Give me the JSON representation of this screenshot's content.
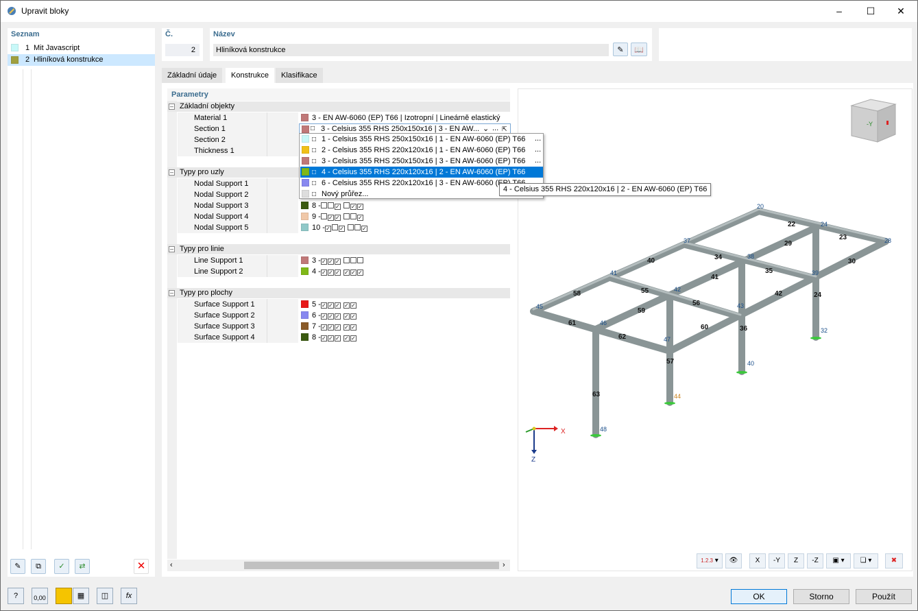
{
  "window": {
    "title": "Upravit bloky",
    "min_icon": "minimize-icon",
    "max_icon": "maximize-icon",
    "close_icon": "close-icon"
  },
  "list": {
    "header": "Seznam",
    "items": [
      {
        "num": "1",
        "name": "Mit Javascript",
        "color": "#c8f8f8"
      },
      {
        "num": "2",
        "name": "Hliníková konstrukce",
        "color": "#a0a040"
      }
    ]
  },
  "number": {
    "label": "Č.",
    "value": "2"
  },
  "name": {
    "label": "Název",
    "value": "Hliníková konstrukce"
  },
  "tabs": [
    "Základní údaje",
    "Konstrukce",
    "Klasifikace"
  ],
  "params": {
    "header": "Parametry"
  },
  "groups": {
    "basic": {
      "title": "Základní objekty",
      "rows": [
        {
          "label": "Material 1",
          "value": "3 - EN AW-6060 (EP) T66 | Izotropní | Lineárně elastický",
          "color": "#c07878"
        },
        {
          "label": "Section 1",
          "value": "3 - Celsius 355 RHS 250x150x16 | 3 - EN AW...",
          "color": "#c07878"
        },
        {
          "label": "Section 2"
        },
        {
          "label": "Thickness 1"
        }
      ]
    },
    "nodes": {
      "title": "Typy pro uzly",
      "rows": [
        {
          "label": "Nodal Support 1"
        },
        {
          "label": "Nodal Support 2"
        },
        {
          "label": "Nodal Support 3",
          "num": "8 -",
          "color": "#3a5a10"
        },
        {
          "label": "Nodal Support 4",
          "num": "9 -",
          "color": "#f0c8a8"
        },
        {
          "label": "Nodal Support 5",
          "num": "10 -",
          "color": "#90c8c8"
        }
      ]
    },
    "lines": {
      "title": "Typy pro linie",
      "rows": [
        {
          "label": "Line Support 1",
          "num": "3 -",
          "color": "#c07878"
        },
        {
          "label": "Line Support 2",
          "num": "4 -",
          "color": "#80b818"
        }
      ]
    },
    "surfaces": {
      "title": "Typy pro plochy",
      "rows": [
        {
          "label": "Surface Support 1",
          "num": "5 -",
          "color": "#e81818"
        },
        {
          "label": "Surface Support 2",
          "num": "6 -",
          "color": "#8888f0"
        },
        {
          "label": "Surface Support 3",
          "num": "7 -",
          "color": "#8a5a28"
        },
        {
          "label": "Surface Support 4",
          "num": "8 -",
          "color": "#3a5a10"
        }
      ]
    }
  },
  "dropdown": {
    "items": [
      {
        "text": "1 - Celsius 355 RHS 250x150x16 | 1 - EN AW-6060 (EP) T66",
        "color": "#c8f8f8"
      },
      {
        "text": "2 - Celsius 355 RHS 220x120x16 | 1 - EN AW-6060 (EP) T66",
        "color": "#f0c018"
      },
      {
        "text": "3 - Celsius 355 RHS 250x150x16 | 3 - EN AW-6060 (EP) T66",
        "color": "#c07878"
      },
      {
        "text": "4 - Celsius 355 RHS 220x120x16 | 2 - EN AW-6060 (EP) T66",
        "color": "#80b818"
      },
      {
        "text": "6 - Celsius 355 RHS 220x120x16 | 3 - EN AW-6060 (EP) T66",
        "color": "#8888f0"
      }
    ],
    "new_label": "Nový průřez...",
    "tooltip": "4 - Celsius 355 RHS 220x120x16 | 2 - EN AW-6060 (EP) T66",
    "dots": "..."
  },
  "view": {
    "members": [
      "20",
      "28",
      "22",
      "24",
      "23",
      "37",
      "29",
      "34",
      "38",
      "35",
      "40",
      "41",
      "39",
      "30",
      "41",
      "58",
      "55",
      "42",
      "56",
      "42",
      "24",
      "43",
      "59",
      "45",
      "61",
      "46",
      "60",
      "62",
      "36",
      "47",
      "32",
      "57",
      "40",
      "63",
      "44",
      "48"
    ],
    "axes": {
      "x": "X",
      "z": "Z"
    },
    "cube_label": "-Y",
    "toolbar": [
      "1.2.3",
      "",
      "X",
      "-Y",
      "Z",
      "-Z",
      "",
      ""
    ]
  },
  "buttons": {
    "ok": "OK",
    "cancel": "Storno",
    "apply": "Použít"
  },
  "footer": {
    "value": "0,00"
  }
}
